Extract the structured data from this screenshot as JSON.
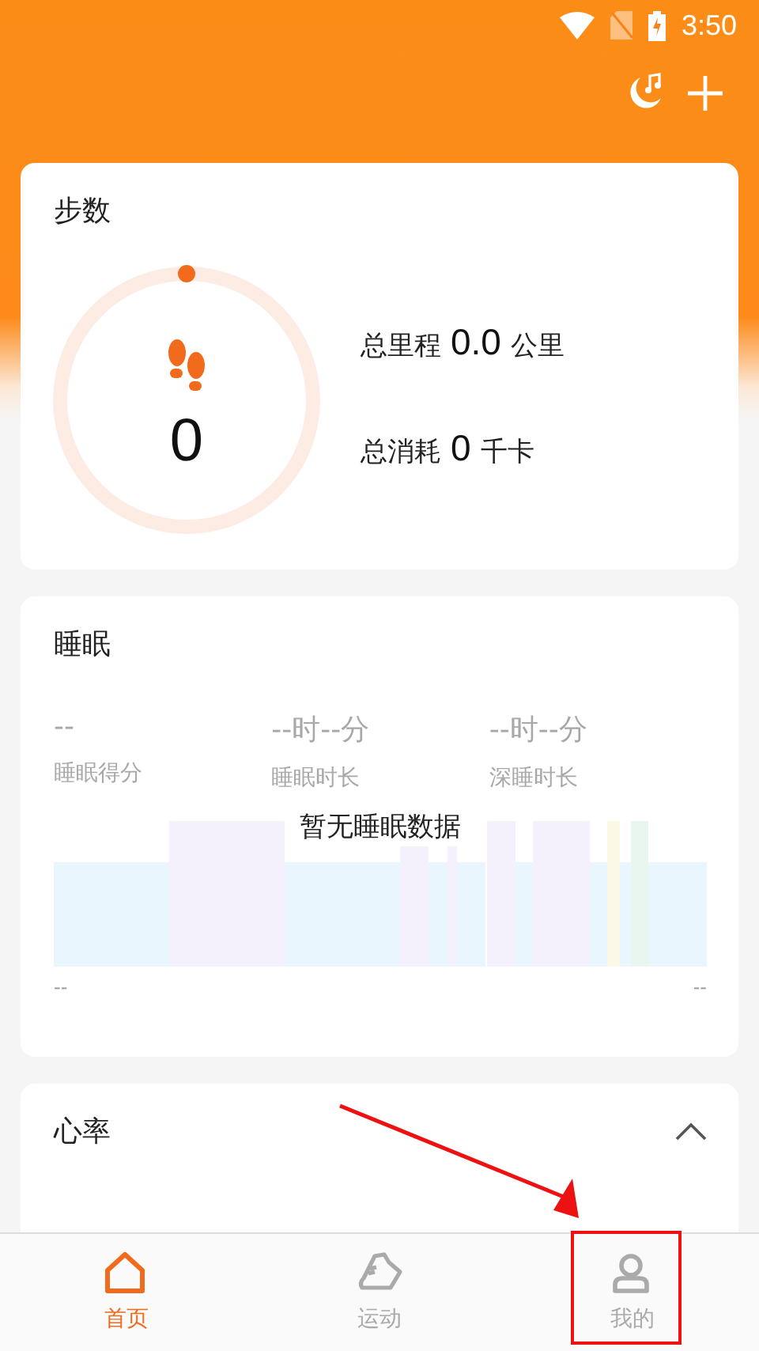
{
  "status_bar": {
    "time": "3:50"
  },
  "steps": {
    "title": "步数",
    "count": "0",
    "level": 0,
    "stats": [
      {
        "label": "总里程",
        "value": "0.0",
        "unit": "公里"
      },
      {
        "label": "总消耗",
        "value": "0",
        "unit": "千卡"
      }
    ]
  },
  "sleep": {
    "title": "睡眠",
    "metrics": [
      {
        "value": "--",
        "label": "睡眠得分"
      },
      {
        "value": "--时--分",
        "label": "睡眠时长"
      },
      {
        "value": "--时--分",
        "label": "深睡时长"
      }
    ],
    "empty_message": "暂无睡眠数据",
    "axis_start": "--",
    "axis_end": "--"
  },
  "heart_rate": {
    "title": "心率",
    "expanded": true
  },
  "nav": [
    {
      "label": "首页",
      "selected": true,
      "highlighted": false
    },
    {
      "label": "运动",
      "selected": false,
      "highlighted": false
    },
    {
      "label": "我的",
      "selected": false,
      "highlighted": true
    }
  ]
}
